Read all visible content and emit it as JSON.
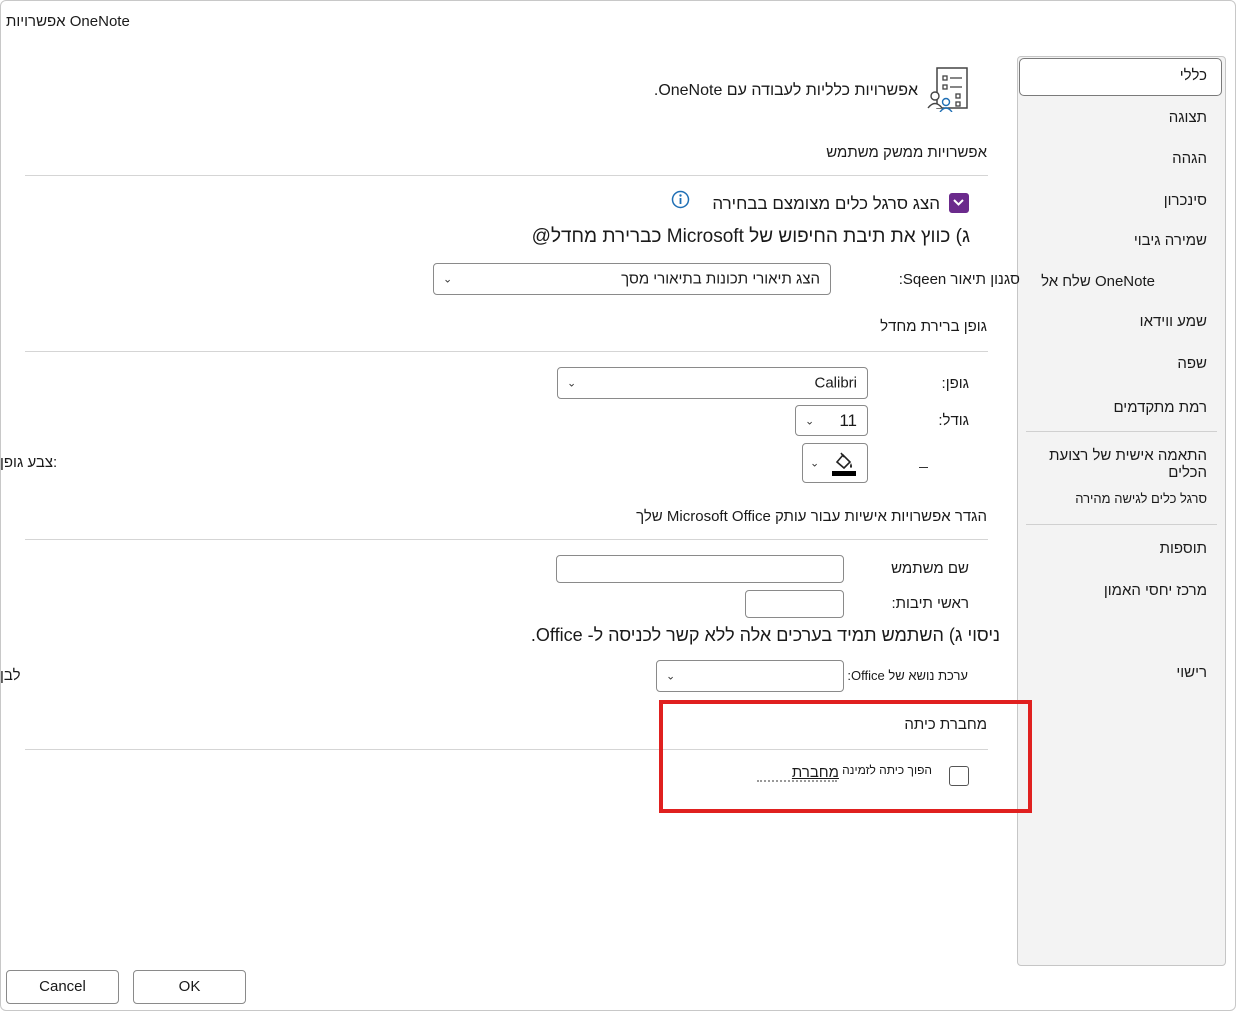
{
  "window": {
    "title": "אפשרויות OneNote"
  },
  "sidebar": {
    "items": [
      {
        "label": "כללי",
        "selected": true
      },
      {
        "label": "תצוגה"
      },
      {
        "label": "הגהה"
      },
      {
        "label": "סינכרון"
      },
      {
        "label": "שמירה גיבוי"
      },
      {
        "label": "שלח אל OneNote"
      },
      {
        "label": "שמע ווידאו"
      },
      {
        "label": "שפה"
      },
      {
        "label": "רמת מתקדמים"
      },
      {
        "label": "התאמה אישית של רצועת הכלים"
      },
      {
        "label": "סרגל כלים לגישה מהירה"
      },
      {
        "label": "תוספות"
      },
      {
        "label": "מרכז יחסי האמון"
      },
      {
        "label": "רישוי"
      }
    ]
  },
  "header": {
    "text": "אפשרויות כלליות לעבודה עם OneNote."
  },
  "ui_options": {
    "title": "אפשרויות ממשק משתמש",
    "mini_toolbar_label": "הצג סרגל כלים מצומצם בבחירה",
    "mini_toolbar_checked": true,
    "search_text": "ג) כווץ את תיבת החיפוש של Microsoft כברירת מחדל@",
    "screentip_label": "סגנון תיאור Sqeen:",
    "screentip_value": "הצג תיאורי תכונות בתיאורי מסך"
  },
  "default_font": {
    "title": "גופן ברירת מחדל",
    "font_label": "גופן:",
    "font_value": "Calibri",
    "size_label": "גודל:",
    "size_value": "11",
    "color_label": "צבע גופן:"
  },
  "personalize": {
    "title": "הגדר אפשרויות אישיות עבור עותק Microsoft  Office שלך",
    "username_label": "שם משתמש",
    "username_value": "",
    "initials_label": "ראשי תיבות:",
    "initials_value": "",
    "always_use_text": "ניסוי ג) השתמש תמיד בערכים אלה ללא קשר לכניסה ל- Office.",
    "theme_label": "ערכת נושא של Office:",
    "theme_value": "",
    "theme_left_label": "לבן"
  },
  "class_notebook": {
    "title": "מחברת כיתה",
    "checkbox_label": "הפוך כיתה לזמינה",
    "checkbox_label_2": "מחברת",
    "checkbox_checked": false
  },
  "buttons": {
    "ok": "OK",
    "cancel": "Cancel"
  },
  "colors": {
    "accent": "#6b2a8c",
    "highlight": "#e0201f",
    "info": "#1f6fb5"
  }
}
